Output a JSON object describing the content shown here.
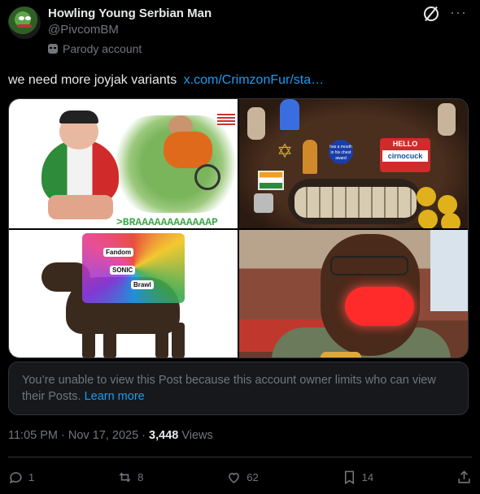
{
  "author": {
    "name": "Howling Young Serbian Man",
    "handle": "@PivcomBM",
    "label": "Parody account"
  },
  "post": {
    "text": "we need more joyjak variants",
    "link": "x.com/CrimzonFur/sta…",
    "image_captions": {
      "tile1_caption": ">BRAAAAAAAAAAAAP",
      "tile2_hello": "HELLO",
      "tile2_name": "cirnocuck",
      "tile2_medal": "has a mouth in his chest award",
      "tile3_stickers": [
        "Fandom",
        "SONIC",
        "Brawl"
      ]
    }
  },
  "notice": {
    "message": "You’re unable to view this Post because this account owner limits who can view their Posts.",
    "learn_more": "Learn more"
  },
  "meta": {
    "time": "11:05 PM · Nov 17, 2025 · ",
    "views_count": "3,448",
    "views_label": " Views"
  },
  "actions": {
    "replies": "1",
    "reposts": "8",
    "likes": "62",
    "bookmarks": "14"
  },
  "colors": {
    "background": "#000000",
    "text_primary": "#e7e9ea",
    "text_secondary": "#71767b",
    "link": "#1d9bf0",
    "notice_bg": "#16181c"
  }
}
